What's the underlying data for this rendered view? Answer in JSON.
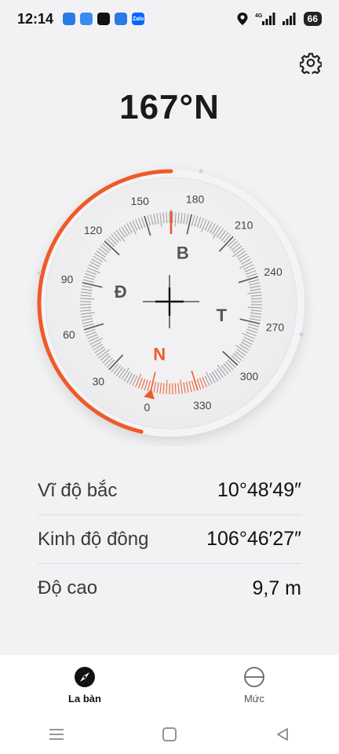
{
  "status_bar": {
    "time": "12:14",
    "network": "4G",
    "battery": "66",
    "notifications": [
      {
        "name": "app-icon",
        "label": "",
        "color": "#2b7be4"
      },
      {
        "name": "app-icon",
        "label": "",
        "color": "#3a8df0"
      },
      {
        "name": "tiktok-icon",
        "label": "",
        "color": "#111111"
      },
      {
        "name": "app-icon",
        "label": "",
        "color": "#2b7be4"
      },
      {
        "name": "zalo-icon",
        "label": "Zalo",
        "color": "#0068ff"
      }
    ]
  },
  "heading": {
    "value": "167°N"
  },
  "compass": {
    "heading_degrees": 167,
    "accent_color": "#f05a28",
    "degree_labels": [
      "0",
      "30",
      "60",
      "90",
      "120",
      "150",
      "180",
      "210",
      "240",
      "270",
      "300",
      "330"
    ],
    "directions": {
      "north": "N",
      "east": "Đ",
      "west": "T",
      "south": "B"
    }
  },
  "info": [
    {
      "label": "Vĩ độ bắc",
      "value": "10°48′49″"
    },
    {
      "label": "Kinh độ đông",
      "value": "106°46′27″"
    },
    {
      "label": "Độ cao",
      "value": "9,7 m"
    }
  ],
  "tabs": [
    {
      "label": "La bàn",
      "icon": "compass-icon",
      "active": true
    },
    {
      "label": "Mức",
      "icon": "level-icon",
      "active": false
    }
  ],
  "nav": [
    "recents-icon",
    "home-icon",
    "back-icon"
  ]
}
